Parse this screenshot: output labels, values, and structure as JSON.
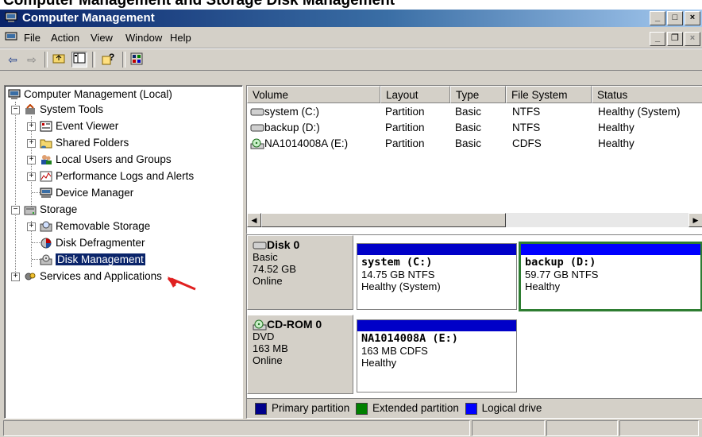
{
  "caption": "Computer Management and Storage Disk Management",
  "window": {
    "title": "Computer Management"
  },
  "menu": {
    "items": [
      "File",
      "Action",
      "View",
      "Window",
      "Help"
    ]
  },
  "tree": {
    "root": "Computer Management (Local)",
    "system_tools": "System Tools",
    "event_viewer": "Event Viewer",
    "shared_folders": "Shared Folders",
    "local_users": "Local Users and Groups",
    "perf_logs": "Performance Logs and Alerts",
    "device_manager": "Device Manager",
    "storage": "Storage",
    "removable_storage": "Removable Storage",
    "disk_defrag": "Disk Defragmenter",
    "disk_management": "Disk Management",
    "services": "Services and Applications"
  },
  "volumes": {
    "headers": [
      "Volume",
      "Layout",
      "Type",
      "File System",
      "Status"
    ],
    "rows": [
      [
        "system (C:)",
        "Partition",
        "Basic",
        "NTFS",
        "Healthy (System)"
      ],
      [
        "backup (D:)",
        "Partition",
        "Basic",
        "NTFS",
        "Healthy"
      ],
      [
        "NA1014008A (E:)",
        "Partition",
        "Basic",
        "CDFS",
        "Healthy"
      ]
    ]
  },
  "disks": [
    {
      "name": "Disk 0",
      "type": "Basic",
      "size": "74.52 GB",
      "state": "Online",
      "partitions": [
        {
          "name": "system  (C:)",
          "size": "14.75 GB NTFS",
          "status": "Healthy (System)"
        },
        {
          "name": "backup  (D:)",
          "size": "59.77 GB NTFS",
          "status": "Healthy"
        }
      ]
    },
    {
      "name": "CD-ROM 0",
      "type": "DVD",
      "size": "163 MB",
      "state": "Online",
      "partitions": [
        {
          "name": "NA1014008A  (E:)",
          "size": "163 MB CDFS",
          "status": "Healthy"
        }
      ]
    }
  ],
  "legend": {
    "items": [
      {
        "label": "Primary partition",
        "color": "#00008b"
      },
      {
        "label": "Extended partition",
        "color": "#008000"
      },
      {
        "label": "Logical drive",
        "color": "#0000ff"
      }
    ]
  },
  "colors": {
    "title_start": "#0a246a",
    "title_end": "#a6caf0",
    "selection": "#0a246a",
    "partition_bar": "#0000c8",
    "extended_border": "#2e7d32",
    "arrow": "#e02020"
  },
  "icons": [
    "computer-icon",
    "tools-icon",
    "event-viewer-icon",
    "folder-icon",
    "users-icon",
    "performance-icon",
    "device-manager-icon",
    "storage-icon",
    "removable-storage-icon",
    "defrag-icon",
    "disk-management-icon",
    "services-icon",
    "drive-icon",
    "cdrom-icon",
    "back-icon",
    "forward-icon",
    "up-icon",
    "show-hide-tree-icon",
    "help-icon",
    "properties-icon"
  ]
}
